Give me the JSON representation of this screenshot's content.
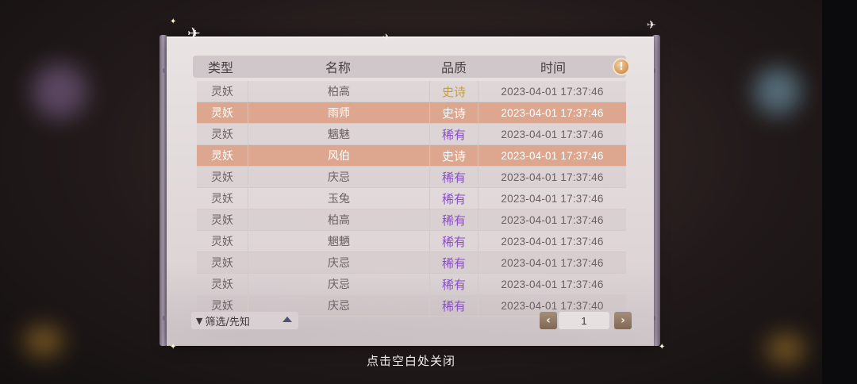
{
  "header": {
    "type": "类型",
    "name": "名称",
    "quality": "品质",
    "time": "时间",
    "info_icon": "!"
  },
  "quality_colors": {
    "epic": "#c9a02a",
    "rare": "#8a4fc7",
    "highlight_row": "#dca78e"
  },
  "rows": [
    {
      "type": "灵妖",
      "name": "柏高",
      "quality": "史诗",
      "quality_kind": "epic",
      "time": "2023-04-01  17:37:46",
      "highlight": false
    },
    {
      "type": "灵妖",
      "name": "雨师",
      "quality": "史诗",
      "quality_kind": "epic",
      "time": "2023-04-01  17:37:46",
      "highlight": true
    },
    {
      "type": "灵妖",
      "name": "魑魅",
      "quality": "稀有",
      "quality_kind": "rare",
      "time": "2023-04-01  17:37:46",
      "highlight": false
    },
    {
      "type": "灵妖",
      "name": "风伯",
      "quality": "史诗",
      "quality_kind": "epic",
      "time": "2023-04-01  17:37:46",
      "highlight": true
    },
    {
      "type": "灵妖",
      "name": "庆忌",
      "quality": "稀有",
      "quality_kind": "rare",
      "time": "2023-04-01  17:37:46",
      "highlight": false
    },
    {
      "type": "灵妖",
      "name": "玉兔",
      "quality": "稀有",
      "quality_kind": "rare",
      "time": "2023-04-01  17:37:46",
      "highlight": false
    },
    {
      "type": "灵妖",
      "name": "柏高",
      "quality": "稀有",
      "quality_kind": "rare",
      "time": "2023-04-01  17:37:46",
      "highlight": false
    },
    {
      "type": "灵妖",
      "name": "魍魉",
      "quality": "稀有",
      "quality_kind": "rare",
      "time": "2023-04-01  17:37:46",
      "highlight": false
    },
    {
      "type": "灵妖",
      "name": "庆忌",
      "quality": "稀有",
      "quality_kind": "rare",
      "time": "2023-04-01  17:37:46",
      "highlight": false
    },
    {
      "type": "灵妖",
      "name": "庆忌",
      "quality": "稀有",
      "quality_kind": "rare",
      "time": "2023-04-01  17:37:46",
      "highlight": false
    },
    {
      "type": "灵妖",
      "name": "庆忌",
      "quality": "稀有",
      "quality_kind": "rare",
      "time": "2023-04-01  17:37:40",
      "highlight": false
    }
  ],
  "filter": {
    "label": "筛选/先知",
    "icon": "funnel-icon"
  },
  "pagination": {
    "prev": "‹",
    "page": "1",
    "next": "›"
  },
  "close_hint": "点击空白处关闭"
}
